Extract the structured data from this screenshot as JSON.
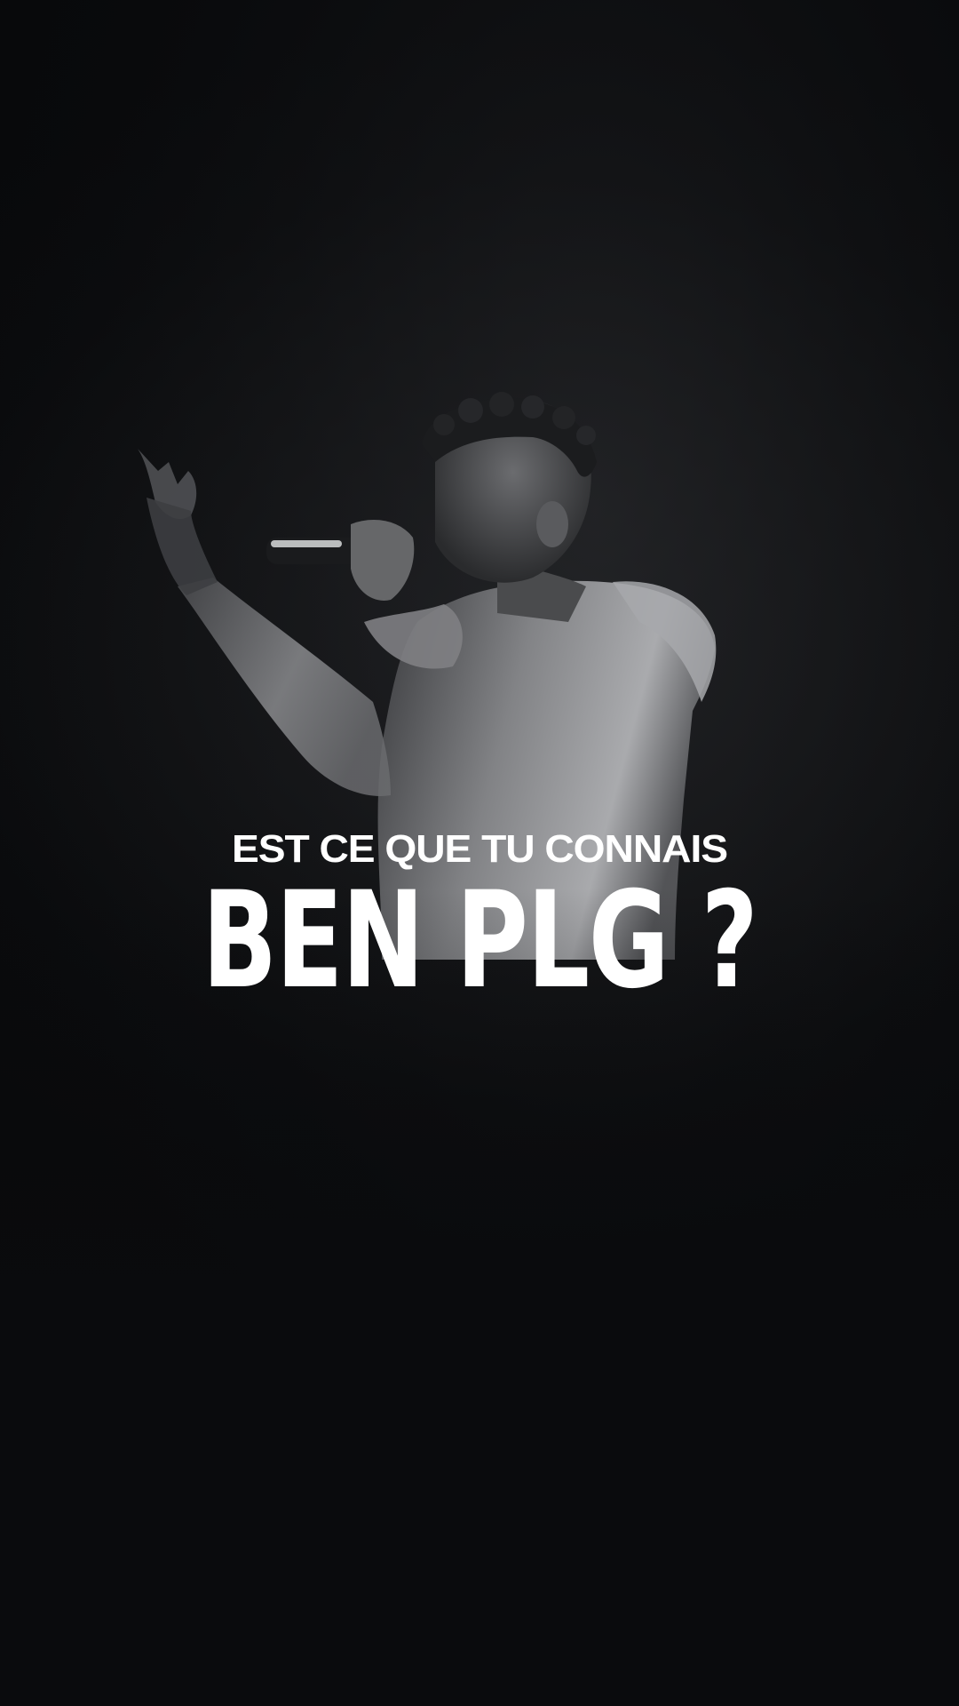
{
  "overlay": {
    "subtitle": "EST CE QUE TU CONNAIS",
    "title": "BEN PLG ?"
  },
  "colors": {
    "background": "#0a0b0d",
    "text": "#ffffff"
  }
}
